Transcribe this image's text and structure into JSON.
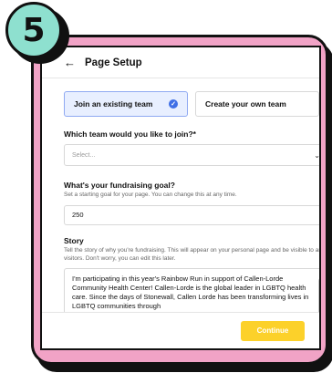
{
  "step": {
    "number": "5",
    "color": "#8ee0cf"
  },
  "header": {
    "back_icon": "arrow-left-icon",
    "title": "Page Setup"
  },
  "team_options": {
    "join_label": "Join an existing team",
    "create_label": "Create your own team",
    "selected": "join"
  },
  "team_select": {
    "label": "Which team would you like to join?*",
    "placeholder": "Select..."
  },
  "goal": {
    "label": "What's your fundraising goal?",
    "helper": "Set a starting goal for your page. You can change this at any time.",
    "value": "250"
  },
  "story": {
    "label": "Story",
    "helper": "Tell the story of why you're fundraising. This will appear on your personal page and be visible to any visitors. Don't worry, you can edit this later.",
    "value": "I'm participating in this year's Rainbow Run in support of Callen-Lorde Community Health Center! Callen-Lorde is the global leader in LGBTQ health care. Since the days of Stonewall, Callen Lorde has been transforming lives in LGBTQ communities through"
  },
  "footer": {
    "continue_label": "Continue",
    "button_color": "#fcd12a"
  },
  "colors": {
    "frame": "#f1a3c6",
    "accent_blue": "#3f6fe6"
  }
}
